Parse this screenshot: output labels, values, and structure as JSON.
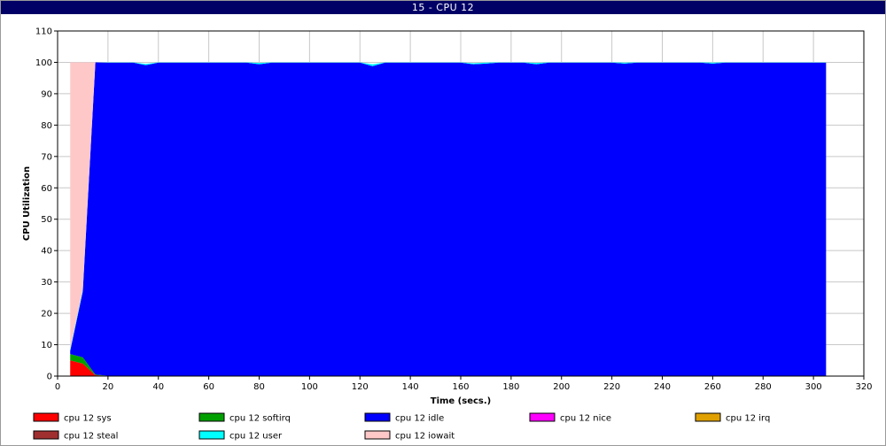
{
  "window_title": "15 - CPU 12",
  "chart_data": {
    "type": "area",
    "stacked": true,
    "title": "15 - CPU 12",
    "xlabel": "Time (secs.)",
    "ylabel": "CPU Utilization",
    "xlim": [
      0,
      320
    ],
    "ylim": [
      0,
      110
    ],
    "x_ticks": [
      0,
      20,
      40,
      60,
      80,
      100,
      120,
      140,
      160,
      180,
      200,
      220,
      240,
      260,
      280,
      300,
      320
    ],
    "y_ticks": [
      0,
      10,
      20,
      30,
      40,
      50,
      60,
      70,
      80,
      90,
      100,
      110
    ],
    "grid": true,
    "legend_position": "bottom",
    "x": [
      5,
      10,
      15,
      20,
      25,
      30,
      35,
      40,
      45,
      50,
      55,
      60,
      65,
      70,
      75,
      80,
      85,
      90,
      95,
      100,
      105,
      110,
      115,
      120,
      125,
      130,
      135,
      140,
      145,
      150,
      155,
      160,
      165,
      170,
      175,
      180,
      185,
      190,
      195,
      200,
      205,
      210,
      215,
      220,
      225,
      230,
      235,
      240,
      245,
      250,
      255,
      260,
      265,
      270,
      275,
      280,
      285,
      290,
      295,
      300,
      305
    ],
    "series": [
      {
        "name": "cpu 12 sys",
        "color": "#ff0000",
        "values": [
          5.0,
          4.0,
          0.3,
          0.1,
          0.1,
          0.1,
          0.1,
          0.1,
          0.1,
          0.1,
          0.1,
          0.1,
          0.1,
          0.1,
          0.1,
          0.1,
          0.1,
          0.1,
          0.1,
          0.1,
          0.1,
          0.1,
          0.1,
          0.1,
          0.1,
          0.1,
          0.1,
          0.1,
          0.1,
          0.1,
          0.1,
          0.1,
          0.1,
          0.1,
          0.1,
          0.1,
          0.1,
          0.1,
          0.1,
          0.1,
          0.1,
          0.1,
          0.1,
          0.1,
          0.1,
          0.1,
          0.1,
          0.1,
          0.1,
          0.1,
          0.1,
          0.1,
          0.1,
          0.1,
          0.1,
          0.1,
          0.1,
          0.1,
          0.1,
          0.1,
          0.1
        ]
      },
      {
        "name": "cpu 12 softirq",
        "color": "#00a000",
        "values": [
          2.0,
          2.0,
          0.2,
          0.0,
          0.0,
          0.0,
          0.0,
          0.0,
          0.0,
          0.0,
          0.0,
          0.0,
          0.0,
          0.0,
          0.0,
          0.0,
          0.0,
          0.0,
          0.0,
          0.0,
          0.0,
          0.0,
          0.0,
          0.0,
          0.0,
          0.0,
          0.0,
          0.0,
          0.0,
          0.0,
          0.0,
          0.0,
          0.0,
          0.0,
          0.0,
          0.0,
          0.0,
          0.0,
          0.0,
          0.0,
          0.0,
          0.0,
          0.0,
          0.0,
          0.0,
          0.0,
          0.0,
          0.0,
          0.0,
          0.0,
          0.0,
          0.0,
          0.0,
          0.0,
          0.0,
          0.0,
          0.0,
          0.0,
          0.0,
          0.0,
          0.0
        ]
      },
      {
        "name": "cpu 12 idle",
        "color": "#0000ff",
        "values": [
          1.0,
          21.0,
          99.5,
          99.8,
          99.8,
          99.8,
          99.0,
          99.8,
          99.8,
          99.8,
          99.8,
          99.8,
          99.8,
          99.8,
          99.8,
          99.3,
          99.8,
          99.8,
          99.8,
          99.8,
          99.8,
          99.8,
          99.8,
          99.8,
          98.7,
          99.8,
          99.8,
          99.8,
          99.8,
          99.8,
          99.8,
          99.8,
          99.3,
          99.5,
          99.8,
          99.8,
          99.8,
          99.3,
          99.8,
          99.8,
          99.8,
          99.8,
          99.8,
          99.8,
          99.5,
          99.8,
          99.8,
          99.8,
          99.8,
          99.8,
          99.8,
          99.5,
          99.8,
          99.8,
          99.8,
          99.8,
          99.8,
          99.8,
          99.8,
          99.8,
          99.8
        ]
      },
      {
        "name": "cpu 12 nice",
        "color": "#ff00ff",
        "values": [
          0.0,
          0.0,
          0.0,
          0.0,
          0.0,
          0.0,
          0.0,
          0.0,
          0.0,
          0.0,
          0.0,
          0.0,
          0.0,
          0.0,
          0.0,
          0.0,
          0.0,
          0.0,
          0.0,
          0.0,
          0.0,
          0.0,
          0.0,
          0.0,
          0.0,
          0.0,
          0.0,
          0.0,
          0.0,
          0.0,
          0.0,
          0.0,
          0.0,
          0.0,
          0.0,
          0.0,
          0.0,
          0.0,
          0.0,
          0.0,
          0.0,
          0.0,
          0.0,
          0.0,
          0.0,
          0.0,
          0.0,
          0.0,
          0.0,
          0.0,
          0.0,
          0.0,
          0.0,
          0.0,
          0.0,
          0.0,
          0.0,
          0.0,
          0.0,
          0.0,
          0.0
        ]
      },
      {
        "name": "cpu 12 irq",
        "color": "#e0a000",
        "values": [
          0.0,
          0.0,
          0.0,
          0.0,
          0.0,
          0.0,
          0.0,
          0.0,
          0.0,
          0.0,
          0.0,
          0.0,
          0.0,
          0.0,
          0.0,
          0.0,
          0.0,
          0.0,
          0.0,
          0.0,
          0.0,
          0.0,
          0.0,
          0.0,
          0.0,
          0.0,
          0.0,
          0.0,
          0.0,
          0.0,
          0.0,
          0.0,
          0.0,
          0.0,
          0.0,
          0.0,
          0.0,
          0.0,
          0.0,
          0.0,
          0.0,
          0.0,
          0.0,
          0.0,
          0.0,
          0.0,
          0.0,
          0.0,
          0.0,
          0.0,
          0.0,
          0.0,
          0.0,
          0.0,
          0.0,
          0.0,
          0.0,
          0.0,
          0.0,
          0.0,
          0.0
        ]
      },
      {
        "name": "cpu 12 steal",
        "color": "#a03030",
        "values": [
          0.0,
          0.0,
          0.0,
          0.0,
          0.0,
          0.0,
          0.0,
          0.0,
          0.0,
          0.0,
          0.0,
          0.0,
          0.0,
          0.0,
          0.0,
          0.0,
          0.0,
          0.0,
          0.0,
          0.0,
          0.0,
          0.0,
          0.0,
          0.0,
          0.0,
          0.0,
          0.0,
          0.0,
          0.0,
          0.0,
          0.0,
          0.0,
          0.0,
          0.0,
          0.0,
          0.0,
          0.0,
          0.0,
          0.0,
          0.0,
          0.0,
          0.0,
          0.0,
          0.0,
          0.0,
          0.0,
          0.0,
          0.0,
          0.0,
          0.0,
          0.0,
          0.0,
          0.0,
          0.0,
          0.0,
          0.0,
          0.0,
          0.0,
          0.0,
          0.0,
          0.0
        ]
      },
      {
        "name": "cpu 12 user",
        "color": "#00ffff",
        "values": [
          0.5,
          0.5,
          0.0,
          0.1,
          0.1,
          0.1,
          0.4,
          0.1,
          0.1,
          0.1,
          0.1,
          0.1,
          0.1,
          0.1,
          0.1,
          0.4,
          0.1,
          0.1,
          0.1,
          0.1,
          0.1,
          0.1,
          0.1,
          0.1,
          0.6,
          0.1,
          0.1,
          0.1,
          0.1,
          0.1,
          0.1,
          0.1,
          0.3,
          0.3,
          0.1,
          0.1,
          0.1,
          0.4,
          0.1,
          0.1,
          0.1,
          0.1,
          0.1,
          0.1,
          0.3,
          0.1,
          0.1,
          0.1,
          0.1,
          0.1,
          0.1,
          0.3,
          0.1,
          0.1,
          0.1,
          0.1,
          0.1,
          0.1,
          0.1,
          0.1,
          0.1
        ]
      },
      {
        "name": "cpu 12 iowait",
        "color": "#ffc8c8",
        "values": [
          91.5,
          72.5,
          0.0,
          0.0,
          0.0,
          0.0,
          0.0,
          0.0,
          0.0,
          0.0,
          0.0,
          0.0,
          0.0,
          0.0,
          0.0,
          0.0,
          0.0,
          0.0,
          0.0,
          0.0,
          0.0,
          0.0,
          0.0,
          0.0,
          0.0,
          0.0,
          0.0,
          0.0,
          0.0,
          0.0,
          0.0,
          0.0,
          0.0,
          0.0,
          0.0,
          0.0,
          0.0,
          0.0,
          0.0,
          0.0,
          0.0,
          0.0,
          0.0,
          0.0,
          0.0,
          0.0,
          0.0,
          0.0,
          0.0,
          0.0,
          0.0,
          0.0,
          0.0,
          0.0,
          0.0,
          0.0,
          0.0,
          0.0,
          0.0,
          0.0,
          0.0
        ]
      }
    ]
  }
}
